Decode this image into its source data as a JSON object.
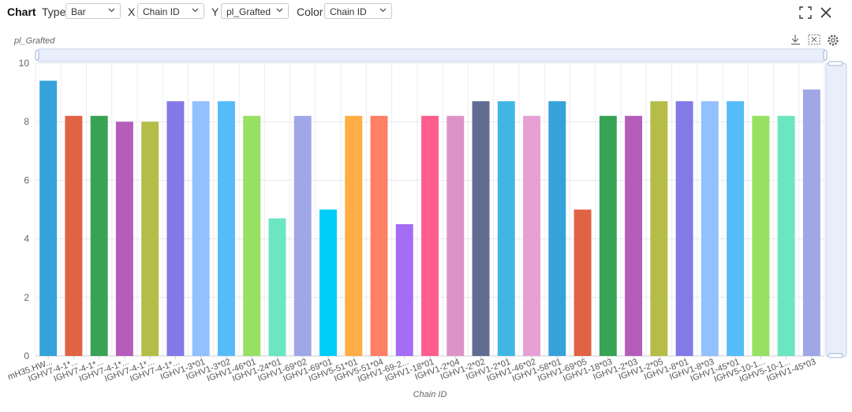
{
  "toolbar": {
    "title": "Chart",
    "type_label": "Type",
    "type_value": "Bar",
    "x_label": "X",
    "x_value": "Chain ID",
    "y_label": "Y",
    "y_value": "pl_Grafted",
    "color_label": "Color",
    "color_value": "Chain ID",
    "icons": {
      "expand": "fullscreen-icon",
      "close": "close-icon",
      "download": "download-icon",
      "reset_zoom": "zoom-reset-icon",
      "settings": "gear-icon"
    }
  },
  "chart_data": {
    "type": "bar",
    "ylabel": "pl_Grafted",
    "xlabel": "Chain ID",
    "ylim": [
      0,
      10
    ],
    "yticks": [
      0,
      2,
      4,
      6,
      8,
      10
    ],
    "grid": true,
    "categories": [
      "mH35.HW...",
      "IGHV7-4-1*...",
      "IGHV7-4-1*...",
      "IGHV7-4-1*...",
      "IGHV7-4-1*...",
      "IGHV7-4-1*...",
      "IGHV1-3*01",
      "IGHV1-3*02",
      "IGHV1-46*01",
      "IGHV1-24*01",
      "IGHV1-69*02",
      "IGHV1-69*01",
      "IGHV5-51*01",
      "IGHV5-51*04",
      "IGHV1-69-2...",
      "IGHV1-18*01",
      "IGHV1-2*04",
      "IGHV1-2*02",
      "IGHV1-2*01",
      "IGHV1-46*02",
      "IGHV1-58*01",
      "IGHV1-69*05",
      "IGHV1-18*03",
      "IGHV1-2*03",
      "IGHV1-2*05",
      "IGHV1-8*01",
      "IGHV1-8*03",
      "IGHV1-45*01",
      "IGHV5-10-1...",
      "IGHV5-10-1...",
      "IGHV1-45*03"
    ],
    "values": [
      9.4,
      8.2,
      8.2,
      8.0,
      8.0,
      8.7,
      8.7,
      8.7,
      8.2,
      4.7,
      8.2,
      5.0,
      8.2,
      8.2,
      4.5,
      8.2,
      8.2,
      8.7,
      8.7,
      8.2,
      8.7,
      5.0,
      8.2,
      8.2,
      8.7,
      8.7,
      8.7,
      8.7,
      8.2,
      8.2,
      9.1
    ],
    "colors": [
      "#36a2da",
      "#e06343",
      "#37a354",
      "#b55dba",
      "#b5bd48",
      "#8379e7",
      "#93c0ff",
      "#56bcf8",
      "#97e062",
      "#6be6c1",
      "#a0a7e6",
      "#00cdf8",
      "#ffad44",
      "#ff8066",
      "#a56cf6",
      "#ff5d8e",
      "#dc93c8",
      "#626c91",
      "#40b6e4",
      "#e6a0d3",
      "#36a2da",
      "#e06343",
      "#37a354",
      "#b55dba",
      "#b5bd48",
      "#8379e7",
      "#93c0ff",
      "#56bcf8",
      "#97e062",
      "#6be6c1",
      "#a0a7e6"
    ]
  }
}
